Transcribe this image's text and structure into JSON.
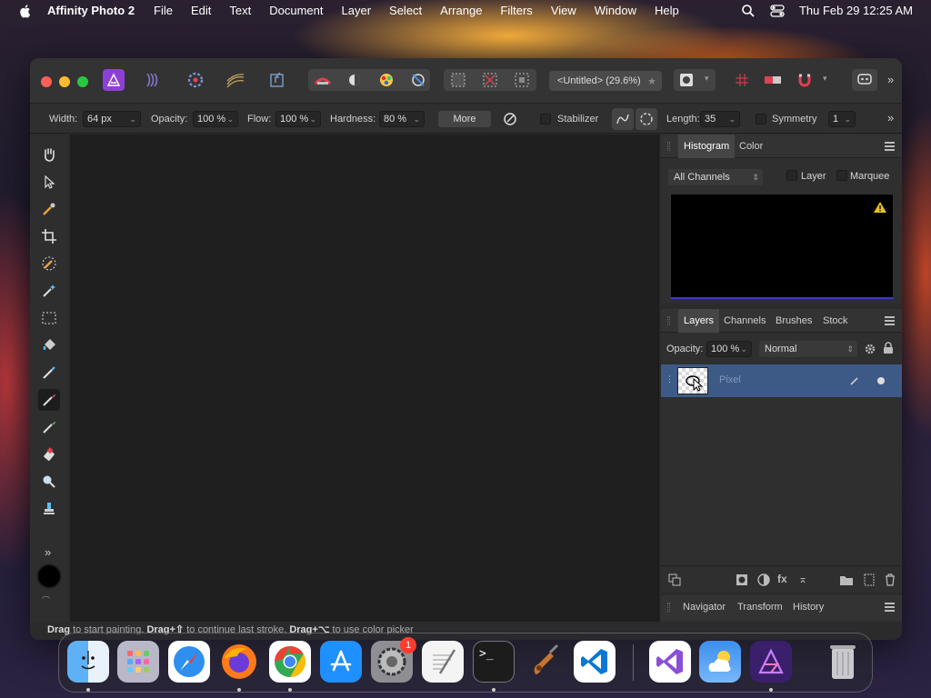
{
  "menubar": {
    "app_name": "Affinity Photo 2",
    "items": [
      "File",
      "Edit",
      "Text",
      "Document",
      "Layer",
      "Select",
      "Arrange",
      "Filters",
      "View",
      "Window",
      "Help"
    ],
    "clock": "Thu Feb 29  12:25 AM"
  },
  "window": {
    "document_title": "<Untitled> (29.6%)"
  },
  "context_toolbar": {
    "width_label": "Width:",
    "width_value": "64 px",
    "opacity_label": "Opacity:",
    "opacity_value": "100 %",
    "flow_label": "Flow:",
    "flow_value": "100 %",
    "hardness_label": "Hardness:",
    "hardness_value": "80 %",
    "more_label": "More",
    "stabilizer_label": "Stabilizer",
    "length_label": "Length:",
    "length_value": "35",
    "symmetry_label": "Symmetry",
    "symmetry_value": "1"
  },
  "histogram_panel": {
    "tabs": [
      "Histogram",
      "Color"
    ],
    "channels_select": "All Channels",
    "layer_check_label": "Layer",
    "marquee_check_label": "Marquee"
  },
  "layers_panel": {
    "tabs": [
      "Layers",
      "Channels",
      "Brushes",
      "Stock"
    ],
    "opacity_label": "Opacity:",
    "opacity_value": "100 %",
    "blend_mode": "Normal",
    "layers": [
      {
        "name": "Pixel",
        "selected": true
      }
    ]
  },
  "bottom_panel": {
    "tabs": [
      "Navigator",
      "Transform",
      "History"
    ]
  },
  "status_bar": {
    "text_bold_1": "Drag",
    "text_1": " to start painting. ",
    "text_bold_2": "Drag+⇧",
    "text_2": " to continue last stroke. ",
    "text_bold_3": "Drag+⌥",
    "text_3": " to use color picker"
  },
  "dock": {
    "apps": [
      "Finder",
      "Launchpad",
      "Safari",
      "Firefox",
      "Chrome",
      "App Store",
      "System Settings",
      "TextEdit",
      "Terminal",
      "Instruments",
      "Visual Studio Code",
      "Visual Studio",
      "Weather",
      "Affinity Photo 2",
      "Trash"
    ],
    "system_settings_badge": "1"
  },
  "colors": {
    "accent": "#3d5a87",
    "affinity_purple": "#8e3fd6"
  }
}
